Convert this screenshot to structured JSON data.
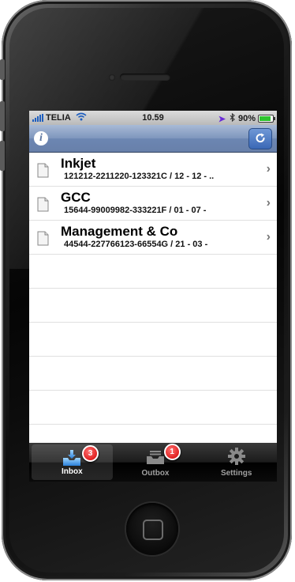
{
  "status_bar": {
    "carrier": "TELIA",
    "time": "10.59",
    "battery": "90%"
  },
  "documents": [
    {
      "title": "Inkjet",
      "subtitle": "121212-2211220-123321C / 12 - 12 - .."
    },
    {
      "title": "GCC",
      "subtitle": "15644-99009982-333221F / 01 - 07 -"
    },
    {
      "title": "Management & Co",
      "subtitle": "44544-227766123-66554G / 21 - 03 -"
    }
  ],
  "tabs": [
    {
      "label": "Inbox",
      "badge": "3"
    },
    {
      "label": "Outbox",
      "badge": "1"
    },
    {
      "label": "Settings"
    }
  ],
  "icons": {
    "info": "info-icon",
    "refresh": "refresh-icon",
    "document": "document-icon",
    "chevron": "chevron-right-icon",
    "inbox": "inbox-tray-icon",
    "outbox": "outbox-tray-icon",
    "settings": "gear-icon"
  },
  "colors": {
    "nav_bar": "#7e96bd",
    "battery": "#2ec32e",
    "badge": "#d40000",
    "signal": "#1f5fbf"
  }
}
